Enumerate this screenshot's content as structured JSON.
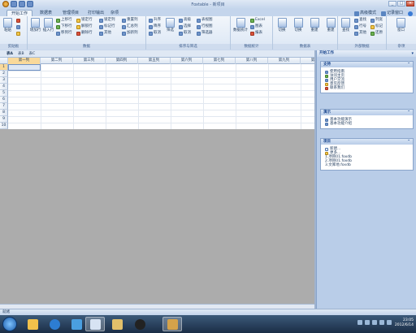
{
  "app": {
    "title": "Foxtable - 新项目"
  },
  "tabs": [
    "开始工作",
    "数据表",
    "管理项目",
    "打印输出",
    "杂项"
  ],
  "tabs_right": [
    "高级模式",
    "记录窗口",
    "帮助"
  ],
  "ribbon": {
    "groups": [
      "剪贴板",
      "数据",
      "排序与筛选",
      "数据统计",
      "数据表",
      "外部数据",
      "杂项"
    ],
    "clipboard": {
      "paste": "粘贴"
    },
    "data": {
      "add_row": "增加行",
      "insert_row": "插入行",
      "up_move": "上移行",
      "down_move": "下移行",
      "to_end": "移到行",
      "locked": "锁定行",
      "unlock": "解锁行",
      "delete": "删除行",
      "lock_col": "锁定列",
      "tag_row": "标记行",
      "other": "其他",
      "filter": "重置列",
      "sum_row": "汇总列",
      "add_col": "加新列"
    },
    "sort": {
      "asc": "升序",
      "desc": "降序",
      "cancel": "取消",
      "filter": "筛选",
      "hi": "高级",
      "sel": "选择",
      "cancel2": "取消"
    },
    "stat": {
      "show": "表视图",
      "row": "行视图",
      "filter": "筛选器"
    },
    "sumtab": {
      "label": "数据统计"
    },
    "excel": {
      "excel": "Excel",
      "chart": "图表",
      "report": "报表"
    },
    "switch": {
      "a": "切换",
      "b": "切换",
      "c": "重建",
      "d": "重建",
      "la": "汇总模式",
      "lb": "合并模式",
      "lc": "分组统计",
      "ld": "交叉统计"
    },
    "misc": {
      "find": "查找",
      "search": "查找",
      "row": "行号",
      "other": "其他",
      "col": "列宽",
      "mark": "标记",
      "restore": "还原",
      "window": "窗口"
    }
  },
  "doc_tabs": [
    "表A",
    "表B",
    "表C"
  ],
  "grid": {
    "columns": [
      "第一列",
      "第二列",
      "第三列",
      "第四列",
      "第五列",
      "第六列",
      "第七列",
      "第八列",
      "第九列",
      "第十列"
    ],
    "rows": [
      "1",
      "2",
      "3",
      "4",
      "5",
      "6",
      "7",
      "8",
      "9",
      "10"
    ]
  },
  "pane": {
    "title": "开始工作",
    "sections": [
      {
        "title": "支持",
        "items": [
          "使用指南",
          "访问主页",
          "用户交流",
          "意见反馈",
          "联系我们"
        ]
      },
      {
        "title": "演示",
        "items": [
          "基本功能演示",
          "基本功能介绍"
        ]
      },
      {
        "title": "项目",
        "items": [
          "新建...",
          "更多...",
          "1.项目01.foxdb",
          "2.项目01.foxdb",
          "3.文库地.foxdb"
        ]
      }
    ]
  },
  "status": {
    "text": "就绪"
  },
  "clock": {
    "time": "23:05",
    "date": "2012/6/14"
  },
  "colors": {
    "ribbon": "#dce7f5",
    "selected": "#f9d99a",
    "workspace": "#acacac"
  }
}
